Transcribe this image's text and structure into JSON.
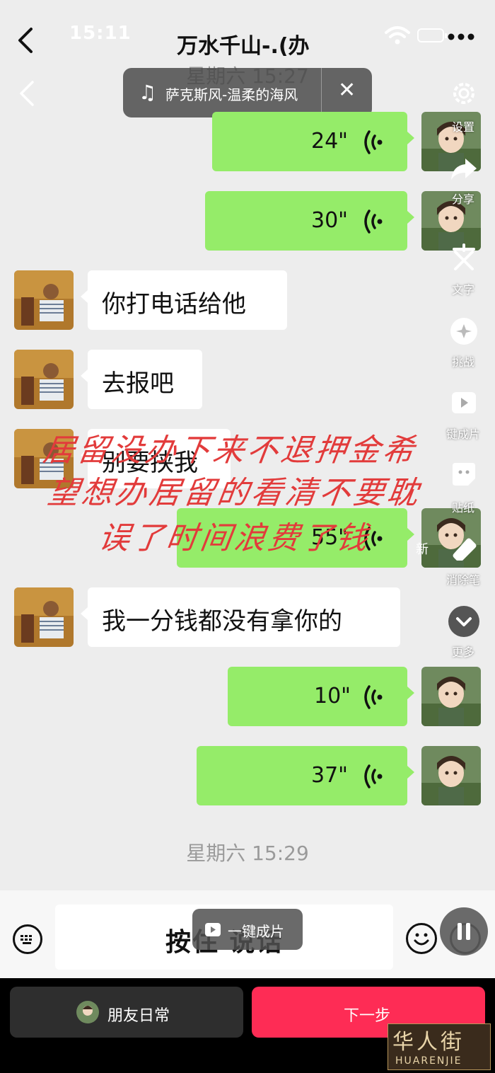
{
  "header": {
    "status_time": "15:11",
    "title": "万水千山-.(办",
    "more_icon": "ellipsis-icon"
  },
  "music": {
    "icon": "music-note-icon",
    "title": "萨克斯风-温柔的海风"
  },
  "timestamps": {
    "first": "星期六 15:27",
    "second": "星期六 15:29"
  },
  "messages": [
    {
      "side": "right",
      "type": "voice",
      "duration": "24\""
    },
    {
      "side": "right",
      "type": "voice",
      "duration": "30\""
    },
    {
      "side": "left",
      "type": "text",
      "text": "你打电话给他"
    },
    {
      "side": "left",
      "type": "text",
      "text": "去报吧"
    },
    {
      "side": "left",
      "type": "text",
      "text": "别要挟我"
    },
    {
      "side": "right",
      "type": "voice",
      "duration": "55\""
    },
    {
      "side": "left",
      "type": "text",
      "text": "我一分钱都没有拿你的"
    },
    {
      "side": "right",
      "type": "voice",
      "duration": "10\""
    },
    {
      "side": "right",
      "type": "voice",
      "duration": "37\""
    }
  ],
  "editor_tools": [
    {
      "label": "设置",
      "icon": "gear-icon"
    },
    {
      "label": "分享",
      "icon": "share-icon"
    },
    {
      "label": "文字",
      "icon": "text-icon"
    },
    {
      "label": "挑战",
      "icon": "challenge-icon"
    },
    {
      "label": "键成片",
      "icon": "clip-icon"
    },
    {
      "label": "贴纸",
      "icon": "sticker-icon"
    },
    {
      "label": "消除笔",
      "icon": "eraser-icon"
    },
    {
      "label": "更多",
      "icon": "chevron-down-icon"
    }
  ],
  "overlay_text": {
    "line1": "居留没办下来不退押金希",
    "line2": "望想办居留的看清不要耽",
    "line3": "误了时间浪费了钱",
    "partial": "新"
  },
  "input": {
    "hold_to_talk": "按住 说话",
    "one_click": "一键成片"
  },
  "bottom": {
    "friends_label": "朋友日常",
    "next_label": "下一步"
  },
  "watermark": {
    "text_large": "华人街",
    "text_small": "HUARENJIE"
  },
  "colors": {
    "green_bubble": "#95ec69",
    "next_button": "#fe2c55",
    "overlay_text": "#e23b3b"
  }
}
